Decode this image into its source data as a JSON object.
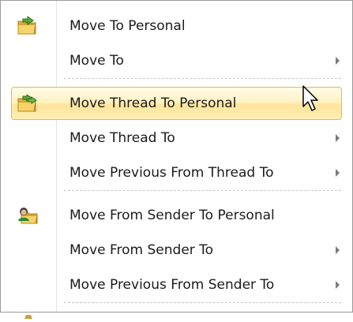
{
  "menu": {
    "items": [
      {
        "label": "Move To Personal",
        "icon": "folder-move-icon"
      },
      {
        "label": "Move To",
        "submenu": true
      },
      {
        "label": "Move Thread To Personal",
        "icon": "thread-folder-move-icon",
        "highlighted": true
      },
      {
        "label": "Move Thread To",
        "submenu": true
      },
      {
        "label": "Move Previous From Thread To",
        "submenu": true
      },
      {
        "label": "Move From Sender To Personal",
        "icon": "sender-folder-move-icon"
      },
      {
        "label": "Move From Sender To",
        "submenu": true
      },
      {
        "label": "Move Previous From Sender To",
        "submenu": true
      }
    ]
  },
  "colors": {
    "highlight_border": "#e9b84a",
    "highlight_fill": "#ffe9a8",
    "text": "#1b1b1b",
    "submenu_arrow": "#7a7a7a"
  }
}
